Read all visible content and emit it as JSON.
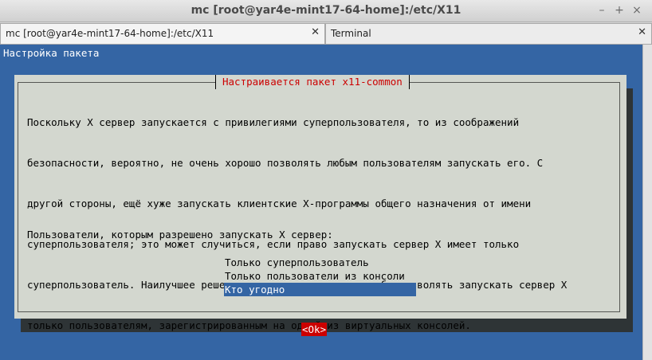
{
  "window": {
    "title": "mc [root@yar4e-mint17-64-home]:/etc/X11",
    "minimize_glyph": "–",
    "maximize_glyph": "+",
    "close_glyph": "×"
  },
  "tabs": [
    {
      "label": "mc [root@yar4e-mint17-64-home]:/etc/X11",
      "close_glyph": "✕",
      "active": true
    },
    {
      "label": "Terminal",
      "close_glyph": "✕",
      "active": false
    }
  ],
  "terminal": {
    "screen_title": "Настройка пакета",
    "colors": {
      "background": "#3465a4",
      "dialog": "#d3d7cf",
      "caption": "#cc0000",
      "selection": "#3465a4",
      "ok_button": "#cc0000"
    },
    "dialog": {
      "caption": "Настраивается пакет x11-common",
      "body_lines": [
        "Поскольку X сервер запускается с привилегиями суперпользователя, то из соображений",
        "безопасности, вероятно, не очень хорошо позволять любым пользователям запускать его. С",
        "другой стороны, ещё хуже запускать клиентские X-программы общего назначения от имени",
        "суперпользователя; это может случиться, если право запускать сервер X имеет только",
        "суперпользователь. Наилучшее решение заключается в том, чтобы позволять запускать сервер X",
        "только пользователям, зарегистрированным на одной из виртуальных консолей."
      ],
      "prompt": "Пользователи, которым разрешено запускать X сервер:",
      "options": [
        {
          "label": "Только суперпользователь",
          "selected": false
        },
        {
          "label": "Только пользователи из консоли",
          "selected": false
        },
        {
          "label": "Кто угодно",
          "selected": true
        }
      ],
      "ok_label": "<Ok>"
    }
  }
}
